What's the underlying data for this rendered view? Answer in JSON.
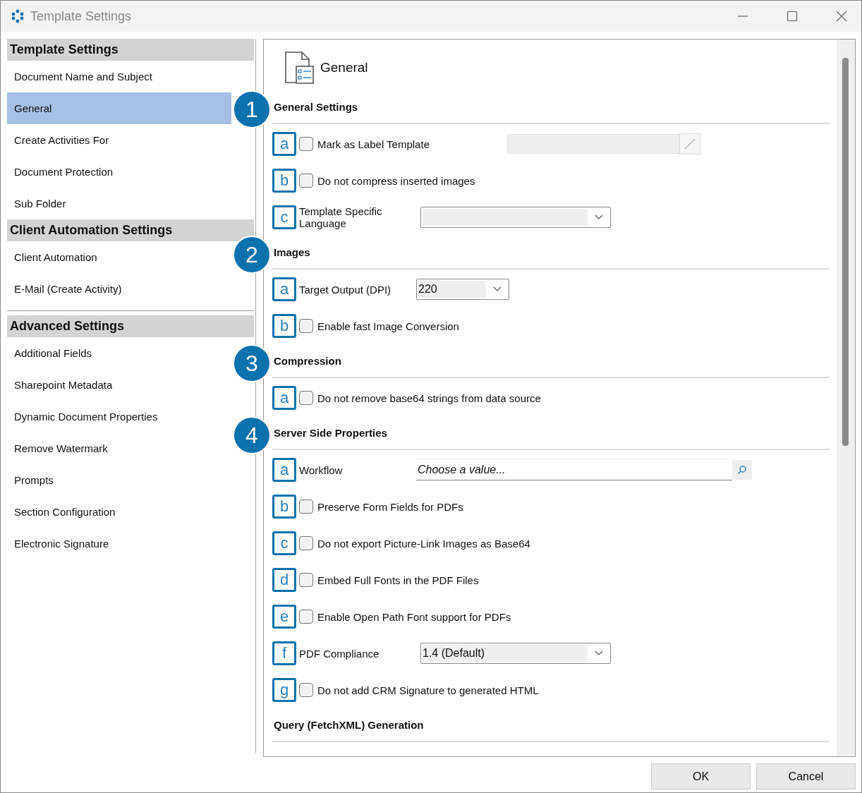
{
  "window": {
    "title": "Template Settings"
  },
  "sidebar": {
    "groups": [
      {
        "title": "Template Settings",
        "items": [
          {
            "label": "Document Name and Subject",
            "selected": false
          },
          {
            "label": "General",
            "selected": true
          },
          {
            "label": "Create Activities For",
            "selected": false
          },
          {
            "label": "Document Protection",
            "selected": false
          },
          {
            "label": "Sub Folder",
            "selected": false
          }
        ]
      },
      {
        "title": "Client Automation Settings",
        "items": [
          {
            "label": "Client Automation",
            "selected": false
          },
          {
            "label": "E-Mail (Create Activity)",
            "selected": false
          }
        ]
      },
      {
        "title": "Advanced Settings",
        "items": [
          {
            "label": "Additional Fields",
            "selected": false
          },
          {
            "label": "Sharepoint Metadata",
            "selected": false
          },
          {
            "label": "Dynamic Document Properties",
            "selected": false
          },
          {
            "label": "Remove Watermark",
            "selected": false
          },
          {
            "label": "Prompts",
            "selected": false
          },
          {
            "label": "Section Configuration",
            "selected": false
          },
          {
            "label": "Electronic Signature",
            "selected": false
          }
        ]
      }
    ]
  },
  "panel": {
    "title": "General",
    "sections": [
      {
        "number": "1",
        "title": "General Settings",
        "rows": [
          {
            "letter": "a",
            "kind": "checkbox_field",
            "label": "Mark as Label Template",
            "checked": false
          },
          {
            "letter": "b",
            "kind": "checkbox",
            "label": "Do not compress inserted images",
            "checked": false
          },
          {
            "letter": "c",
            "kind": "dropdown",
            "label": "Template Specific Language"
          }
        ]
      },
      {
        "number": "2",
        "title": "Images",
        "rows": [
          {
            "letter": "a",
            "kind": "short_dropdown",
            "label": "Target Output (DPI)",
            "value": "220"
          },
          {
            "letter": "b",
            "kind": "checkbox",
            "label": "Enable fast Image Conversion",
            "checked": false
          }
        ]
      },
      {
        "number": "3",
        "title": "Compression",
        "rows": [
          {
            "letter": "a",
            "kind": "checkbox",
            "label": "Do not remove base64 strings from data source",
            "checked": false
          }
        ]
      },
      {
        "number": "4",
        "title": "Server Side Properties",
        "rows": [
          {
            "letter": "a",
            "kind": "lookup",
            "label": "Workflow",
            "placeholder": "Choose a value..."
          },
          {
            "letter": "b",
            "kind": "checkbox",
            "label": "Preserve Form Fields for PDFs",
            "checked": false
          },
          {
            "letter": "c",
            "kind": "checkbox",
            "label": "Do not export Picture-Link Images as Base64",
            "checked": false
          },
          {
            "letter": "d",
            "kind": "checkbox",
            "label": "Embed Full Fonts in the PDF Files",
            "checked": false
          },
          {
            "letter": "e",
            "kind": "checkbox",
            "label": "Enable Open Path Font support for PDFs",
            "checked": false
          },
          {
            "letter": "f",
            "kind": "dropdown",
            "label": "PDF Compliance",
            "value": "1.4 (Default)"
          },
          {
            "letter": "g",
            "kind": "checkbox",
            "label": "Do not add CRM Signature to generated HTML",
            "checked": false
          }
        ]
      },
      {
        "title": "Query (FetchXML) Generation"
      }
    ]
  },
  "buttons": [
    "OK",
    "Cancel"
  ]
}
